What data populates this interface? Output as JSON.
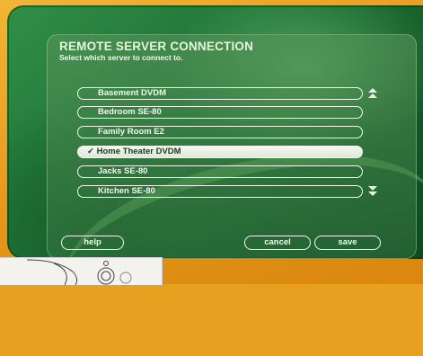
{
  "dialog": {
    "title": "REMOTE SERVER CONNECTION",
    "subtitle": "Select which server to connect to."
  },
  "servers": [
    {
      "label": "Basement DVDM",
      "selected": false
    },
    {
      "label": "Bedroom SE-80",
      "selected": false
    },
    {
      "label": "Family Room E2",
      "selected": false
    },
    {
      "label": "Home Theater DVDM",
      "selected": true
    },
    {
      "label": "Jacks SE-80",
      "selected": false
    },
    {
      "label": "Kitchen SE-80",
      "selected": false
    }
  ],
  "scroll": {
    "up_icon": "double-up-arrow",
    "down_icon": "double-down-arrow"
  },
  "buttons": {
    "help": "help",
    "cancel": "cancel",
    "save": "save"
  },
  "colors": {
    "frame": "#e8a020",
    "screen": "#1f7035",
    "pill_outline": "#f1f7ec",
    "selected_fill": "#e8efe2"
  }
}
